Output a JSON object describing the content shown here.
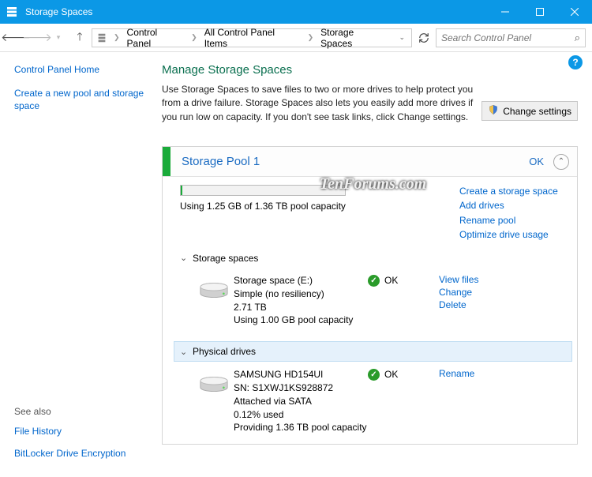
{
  "window": {
    "title": "Storage Spaces"
  },
  "breadcrumbs": {
    "a": "Control Panel",
    "b": "All Control Panel Items",
    "c": "Storage Spaces"
  },
  "search": {
    "placeholder": "Search Control Panel"
  },
  "sidebar": {
    "home": "Control Panel Home",
    "create": "Create a new pool and storage space",
    "see_also": "See also",
    "file_history": "File History",
    "bitlocker": "BitLocker Drive Encryption"
  },
  "page": {
    "title": "Manage Storage Spaces",
    "desc": "Use Storage Spaces to save files to two or more drives to help protect you from a drive failure. Storage Spaces also lets you easily add more drives if you run low on capacity. If you don't see task links, click Change settings.",
    "change_btn": "Change settings"
  },
  "watermark": "TenForums.com",
  "pool": {
    "name": "Storage Pool 1",
    "status": "OK",
    "capacity_text": "Using 1.25 GB of 1.36 TB pool capacity",
    "links": {
      "create": "Create a storage space",
      "add": "Add drives",
      "rename": "Rename pool",
      "optimize": "Optimize drive usage"
    },
    "sections": {
      "spaces": "Storage spaces",
      "drives": "Physical drives"
    },
    "space": {
      "l1": "Storage space (E:)",
      "l2": "Simple (no resiliency)",
      "l3": "2.71 TB",
      "l4": "Using 1.00 GB pool capacity",
      "status": "OK",
      "links": {
        "view": "View files",
        "change": "Change",
        "delete": "Delete"
      }
    },
    "drive": {
      "l1": "SAMSUNG HD154UI",
      "l2": "SN: S1XWJ1KS928872",
      "l3": "Attached via SATA",
      "l4": "0.12% used",
      "l5": "Providing 1.36 TB pool capacity",
      "status": "OK",
      "links": {
        "rename": "Rename"
      }
    }
  }
}
